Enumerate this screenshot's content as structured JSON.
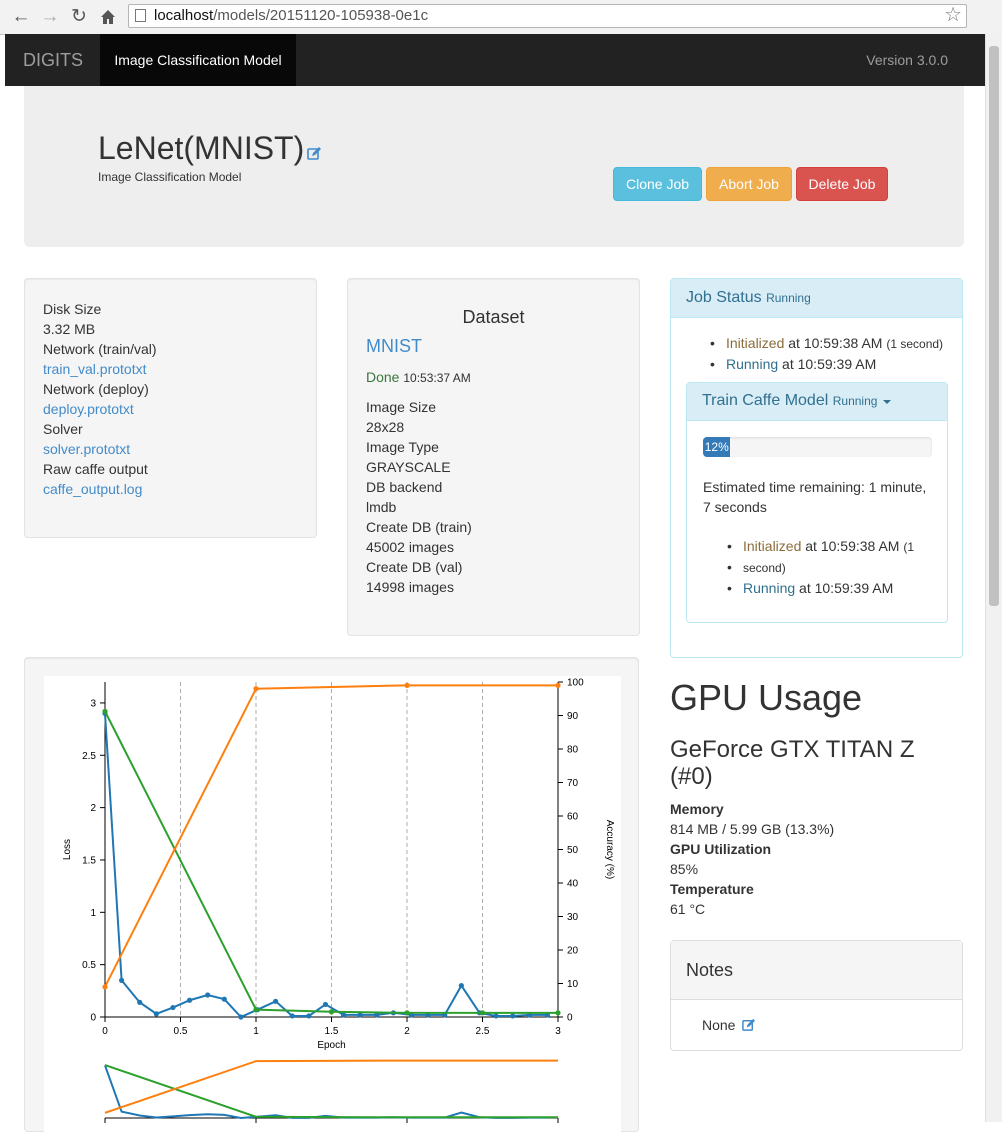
{
  "browser": {
    "url_host": "localhost",
    "url_path": "/models/20151120-105938-0e1c",
    "icons": [
      "back-icon",
      "forward-icon",
      "reload-icon",
      "home-icon",
      "page-icon",
      "bookmark-star-icon"
    ]
  },
  "navbar": {
    "brand": "DIGITS",
    "active_item": "Image Classification Model",
    "version": "Version 3.0.0"
  },
  "header": {
    "title": "LeNet(MNIST)",
    "subtitle": "Image Classification Model",
    "buttons": {
      "clone": "Clone Job",
      "abort": "Abort Job",
      "delete": "Delete Job"
    }
  },
  "files": [
    {
      "label": "Disk Size",
      "value": "3.32 MB",
      "link": false
    },
    {
      "label": "Network (train/val)",
      "value": "train_val.prototxt",
      "link": true
    },
    {
      "label": "Network (deploy)",
      "value": "deploy.prototxt",
      "link": true
    },
    {
      "label": "Solver",
      "value": "solver.prototxt",
      "link": true
    },
    {
      "label": "Raw caffe output",
      "value": "caffe_output.log",
      "link": true
    }
  ],
  "dataset": {
    "heading": "Dataset",
    "name": "MNIST",
    "status": "Done",
    "status_time": "10:53:37 AM",
    "fields": [
      {
        "label": "Image Size",
        "value": "28x28"
      },
      {
        "label": "Image Type",
        "value": "GRAYSCALE"
      },
      {
        "label": "DB backend",
        "value": "lmdb"
      },
      {
        "label": "Create DB (train)",
        "value": "45002 images"
      },
      {
        "label": "Create DB (val)",
        "value": "14998 images"
      }
    ]
  },
  "job_status": {
    "title": "Job Status",
    "state": "Running",
    "events": [
      {
        "name": "Initialized",
        "at": "at 10:59:38 AM",
        "extra": "(1 second)"
      },
      {
        "name": "Running",
        "at": "at 10:59:39 AM",
        "extra": ""
      }
    ],
    "task": {
      "title": "Train Caffe Model",
      "state": "Running",
      "progress_label": "12%",
      "progress_fraction": 0.12,
      "eta_line1": "Estimated time remaining: 1 minute,",
      "eta_line2": "7 seconds",
      "events": [
        {
          "name": "Initialized",
          "at": "at 10:59:38 AM",
          "extra1": "(1",
          "extra2": "second)"
        },
        {
          "name": "Running",
          "at": "at 10:59:39 AM"
        }
      ]
    }
  },
  "gpu": {
    "heading": "GPU Usage",
    "name_line1": "GeForce GTX TITAN Z",
    "name_line2": "(#0)",
    "fields": [
      {
        "label": "Memory",
        "value": "814 MB / 5.99 GB (13.3%)"
      },
      {
        "label": "GPU Utilization",
        "value": "85%"
      },
      {
        "label": "Temperature",
        "value": "61 °C"
      }
    ]
  },
  "notes": {
    "heading": "Notes",
    "value": "None"
  },
  "colors": {
    "series_blue": "#1f77b4",
    "series_orange": "#ff7f0e",
    "series_green": "#2ca02c"
  },
  "chart_data": {
    "type": "line",
    "xlabel": "Epoch",
    "ylabel": "Loss",
    "y2label": "Accuracy (%)",
    "xlim": [
      0,
      3
    ],
    "ylim": [
      0,
      3.2
    ],
    "y2lim": [
      0,
      100
    ],
    "x_ticks": [
      "0",
      "0.5",
      "1",
      "1.5",
      "2",
      "2.5",
      "3"
    ],
    "y_ticks": [
      "0",
      "0.5",
      "1",
      "1.5",
      "2",
      "2.5",
      "3"
    ],
    "y2_ticks": [
      "0",
      "10",
      "20",
      "30",
      "40",
      "50",
      "60",
      "70",
      "80",
      "90",
      "100"
    ],
    "grid": "vertical dashed lines at x ticks",
    "series": [
      {
        "color": "blue",
        "axis": "left",
        "x": [
          0,
          0.11,
          0.23,
          0.34,
          0.45,
          0.56,
          0.68,
          0.79,
          0.9,
          1.01,
          1.13,
          1.24,
          1.35,
          1.46,
          1.58,
          1.69,
          1.8,
          1.91,
          2.03,
          2.14,
          2.25,
          2.36,
          2.48,
          2.59,
          2.7,
          2.81,
          2.93
        ],
        "y": [
          2.9,
          0.35,
          0.14,
          0.03,
          0.09,
          0.16,
          0.21,
          0.17,
          0.0,
          0.07,
          0.15,
          0.01,
          0.01,
          0.12,
          0.02,
          0.02,
          0.02,
          0.04,
          0.02,
          0.02,
          0.02,
          0.3,
          0.04,
          0.01,
          0.01,
          0.02,
          0.02
        ]
      },
      {
        "color": "green",
        "axis": "left",
        "x": [
          0,
          1,
          1.5,
          2,
          2.5,
          3
        ],
        "y": [
          2.92,
          0.07,
          0.05,
          0.04,
          0.04,
          0.04
        ]
      },
      {
        "color": "orange",
        "axis": "right",
        "x": [
          0,
          1,
          2,
          3
        ],
        "y": [
          9,
          98,
          99,
          99
        ]
      }
    ]
  }
}
